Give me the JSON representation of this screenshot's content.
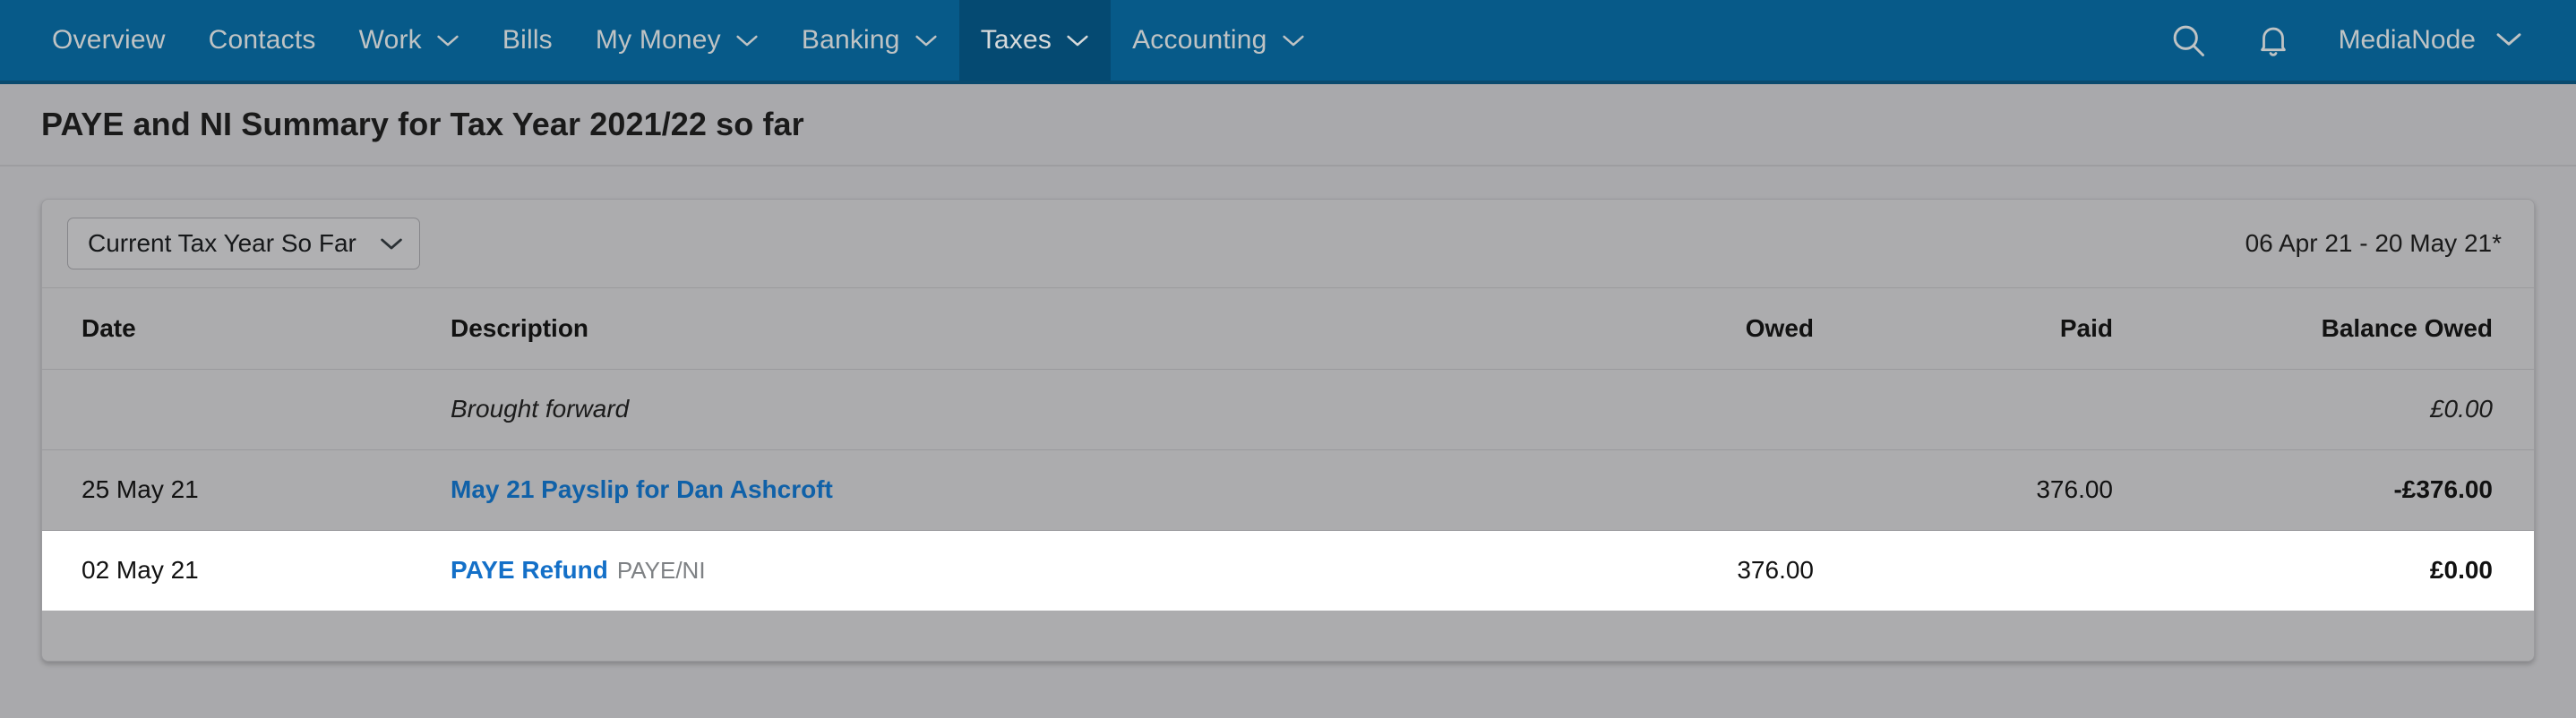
{
  "nav": {
    "items": [
      {
        "label": "Overview",
        "has_caret": false,
        "active": false
      },
      {
        "label": "Contacts",
        "has_caret": false,
        "active": false
      },
      {
        "label": "Work",
        "has_caret": true,
        "active": false
      },
      {
        "label": "Bills",
        "has_caret": false,
        "active": false
      },
      {
        "label": "My Money",
        "has_caret": true,
        "active": false
      },
      {
        "label": "Banking",
        "has_caret": true,
        "active": false
      },
      {
        "label": "Taxes",
        "has_caret": true,
        "active": true
      },
      {
        "label": "Accounting",
        "has_caret": true,
        "active": false
      }
    ],
    "search_icon": "search-icon",
    "notifications_icon": "bell-icon",
    "user": "MediaNode",
    "user_caret_icon": "chevron-down-icon",
    "background_color": "#075a89",
    "active_background_color": "#054a72",
    "text_color": "#bfc3c4"
  },
  "header": {
    "title": "PAYE and NI Summary for Tax Year 2021/22 so far"
  },
  "toolbar": {
    "period_select": {
      "value": "Current Tax Year So Far",
      "caret_icon": "chevron-down-icon"
    },
    "date_range": "06 Apr 21 - 20 May 21*"
  },
  "table": {
    "columns": [
      "Date",
      "Description",
      "Owed",
      "Paid",
      "Balance Owed"
    ],
    "rows": [
      {
        "date": "",
        "description": "Brought forward",
        "description_sub": "",
        "owed": "",
        "paid": "",
        "balance": "£0.00"
      },
      {
        "date": "25 May 21",
        "description": "May 21 Payslip for Dan Ashcroft",
        "description_sub": "",
        "owed": "",
        "paid": "376.00",
        "balance": "-£376.00"
      },
      {
        "date": "02 May 21",
        "description": "PAYE Refund",
        "description_sub": "PAYE/NI",
        "owed": "376.00",
        "paid": "",
        "balance": "£0.00"
      }
    ]
  },
  "colors": {
    "page_background": "#a9a9ac",
    "card_background": "#acacae",
    "link": "#1061a8",
    "highlight_row": "#ffffff"
  }
}
